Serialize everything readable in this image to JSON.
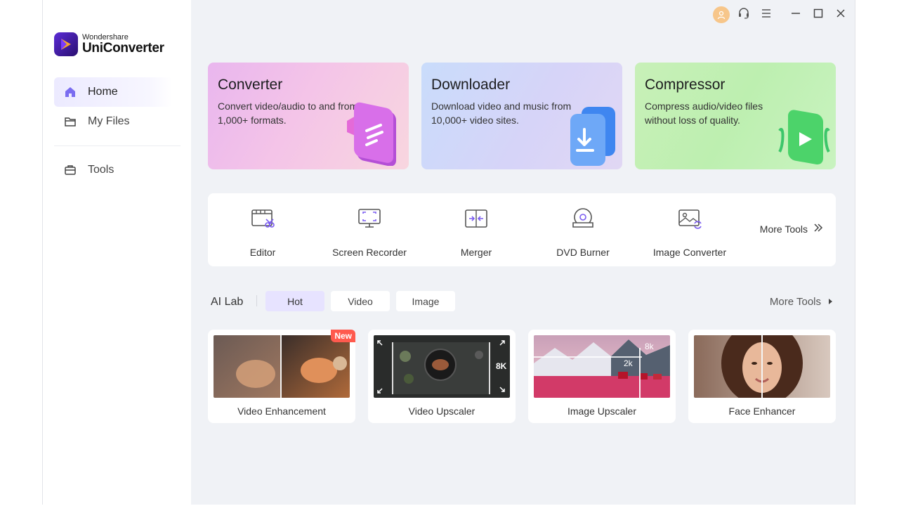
{
  "app": {
    "brand": "Wondershare",
    "name": "UniConverter"
  },
  "sidebar": {
    "items": [
      {
        "label": "Home",
        "icon": "home-icon",
        "active": true
      },
      {
        "label": "My Files",
        "icon": "folder-icon",
        "active": false
      },
      {
        "label": "Tools",
        "icon": "toolbox-icon",
        "active": false
      }
    ]
  },
  "titlebar": {
    "icons": [
      "avatar-icon",
      "headset-icon",
      "menu-icon",
      "minimize-icon",
      "maximize-icon",
      "close-icon"
    ]
  },
  "features": [
    {
      "title": "Converter",
      "desc": "Convert video/audio to and from 1,000+ formats.",
      "icon": "converter-icon"
    },
    {
      "title": "Downloader",
      "desc": "Download video and music from 10,000+ video sites.",
      "icon": "downloader-icon"
    },
    {
      "title": "Compressor",
      "desc": "Compress audio/video files without loss of quality.",
      "icon": "compressor-icon"
    }
  ],
  "tools": [
    {
      "label": "Editor",
      "icon": "editor-icon"
    },
    {
      "label": "Screen Recorder",
      "icon": "screen-recorder-icon"
    },
    {
      "label": "Merger",
      "icon": "merger-icon"
    },
    {
      "label": "DVD Burner",
      "icon": "dvd-burner-icon"
    },
    {
      "label": "Image Converter",
      "icon": "image-converter-icon"
    }
  ],
  "more_tools_label": "More Tools",
  "ailab": {
    "title": "AI Lab",
    "tabs": [
      {
        "label": "Hot",
        "active": true
      },
      {
        "label": "Video",
        "active": false
      },
      {
        "label": "Image",
        "active": false
      }
    ],
    "more_label": "More Tools",
    "cards": [
      {
        "label": "Video Enhancement",
        "badge": "New"
      },
      {
        "label": "Video Upscaler",
        "overlay": "8K"
      },
      {
        "label": "Image Upscaler",
        "overlay_top": "8k",
        "overlay_mid": "2k"
      },
      {
        "label": "Face Enhancer"
      }
    ]
  },
  "colors": {
    "accent": "#6a4cf5",
    "window_bg": "#f0f2f6",
    "badge": "#ff5a4e"
  }
}
